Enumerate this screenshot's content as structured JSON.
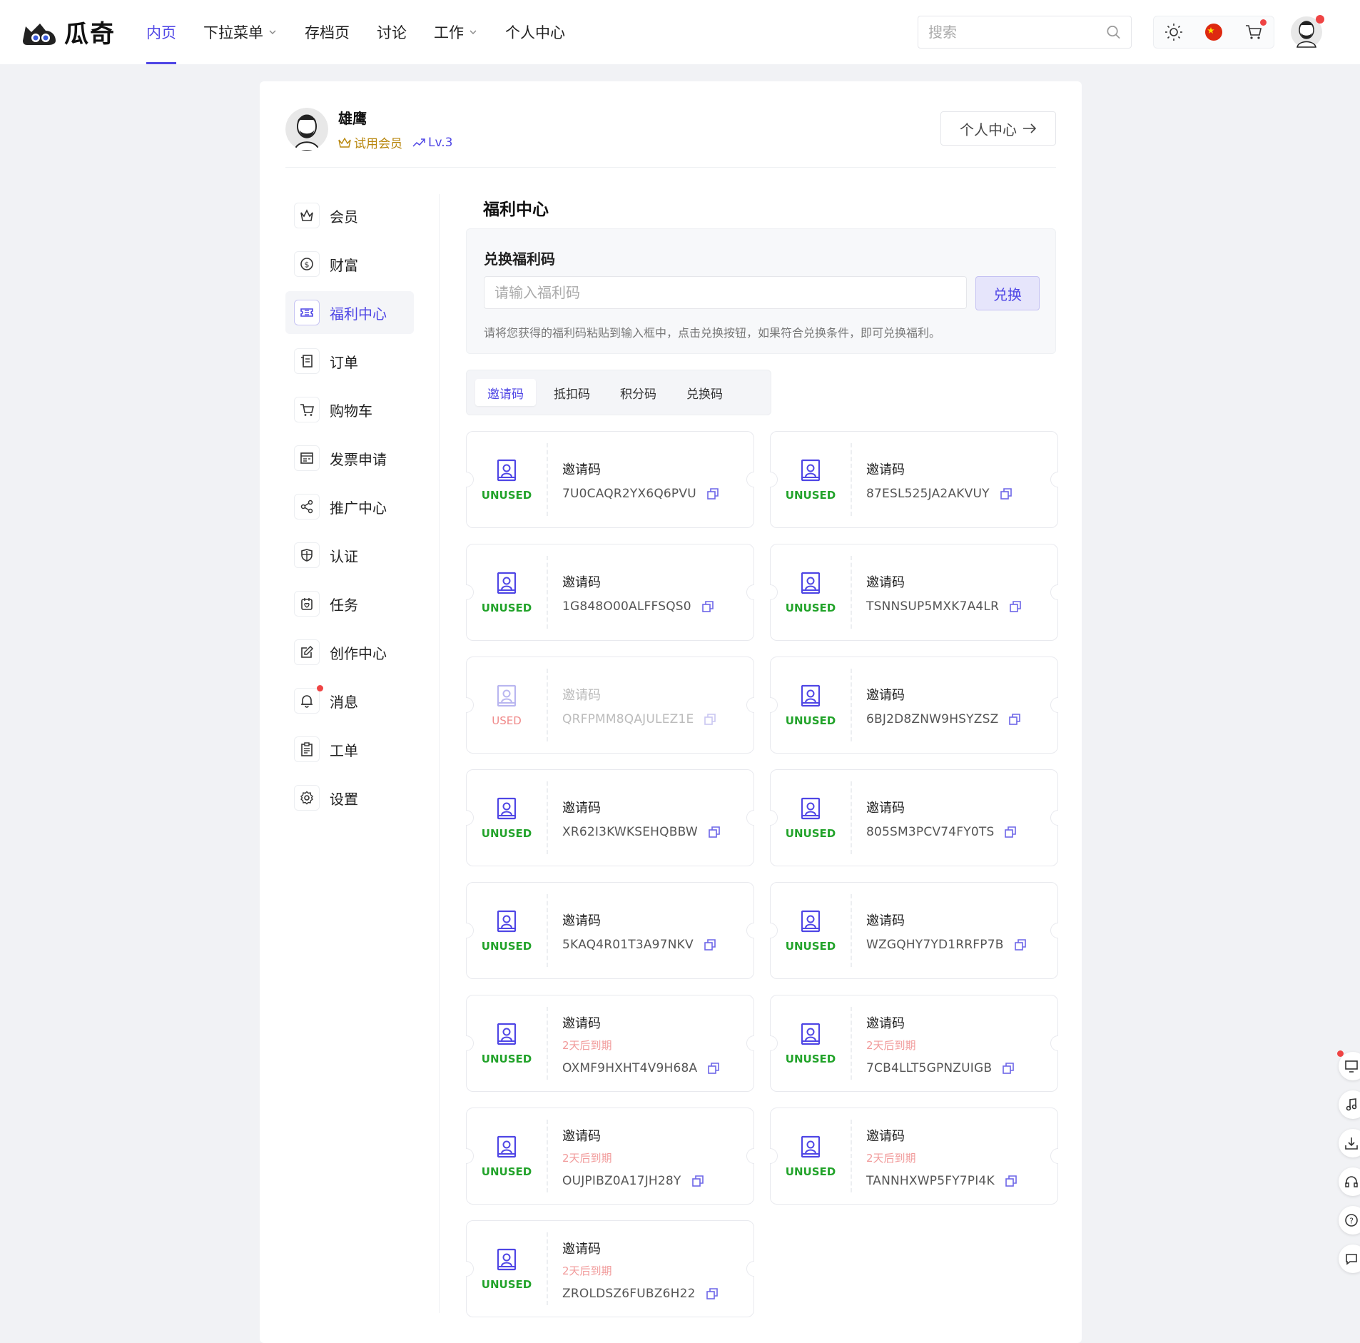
{
  "header": {
    "logo_text": "瓜奇",
    "nav": [
      {
        "label": "内页",
        "active": true,
        "dropdown": false
      },
      {
        "label": "下拉菜单",
        "active": false,
        "dropdown": true
      },
      {
        "label": "存档页",
        "active": false,
        "dropdown": false
      },
      {
        "label": "讨论",
        "active": false,
        "dropdown": false
      },
      {
        "label": "工作",
        "active": false,
        "dropdown": true
      },
      {
        "label": "个人中心",
        "active": false,
        "dropdown": false
      }
    ],
    "search_placeholder": "搜索",
    "tools": [
      "sun-icon",
      "flag-cn-icon",
      "cart-icon"
    ]
  },
  "profile": {
    "name": "雄鹰",
    "member": "试用会员",
    "level": "Lv.3",
    "center_button": "个人中心"
  },
  "sidebar": [
    {
      "label": "会员",
      "icon": "crown-icon",
      "active": false
    },
    {
      "label": "财富",
      "icon": "coin-icon",
      "active": false
    },
    {
      "label": "福利中心",
      "icon": "ticket-icon",
      "active": true
    },
    {
      "label": "订单",
      "icon": "receipt-icon",
      "active": false
    },
    {
      "label": "购物车",
      "icon": "cart-icon",
      "active": false
    },
    {
      "label": "发票申请",
      "icon": "invoice-icon",
      "active": false
    },
    {
      "label": "推广中心",
      "icon": "share-icon",
      "active": false
    },
    {
      "label": "认证",
      "icon": "shield-icon",
      "active": false
    },
    {
      "label": "任务",
      "icon": "task-icon",
      "active": false
    },
    {
      "label": "创作中心",
      "icon": "edit-icon",
      "active": false
    },
    {
      "label": "消息",
      "icon": "bell-icon",
      "active": false,
      "badge": true
    },
    {
      "label": "工单",
      "icon": "clipboard-icon",
      "active": false
    },
    {
      "label": "设置",
      "icon": "gear-icon",
      "active": false
    }
  ],
  "main": {
    "title": "福利中心",
    "redeem": {
      "title": "兑换福利码",
      "placeholder": "请输入福利码",
      "button": "兑换",
      "hint": "请将您获得的福利码粘贴到输入框中，点击兑换按钮，如果符合兑换条件，即可兑换福利。"
    },
    "tabs": [
      {
        "label": "邀请码",
        "active": true
      },
      {
        "label": "抵扣码",
        "active": false
      },
      {
        "label": "积分码",
        "active": false
      },
      {
        "label": "兑换码",
        "active": false
      }
    ],
    "coupons": [
      {
        "label": "邀请码",
        "code": "7U0CAQR2YX6Q6PVU",
        "status": "UNUSED",
        "expire": ""
      },
      {
        "label": "邀请码",
        "code": "87ESL525JA2AKVUY",
        "status": "UNUSED",
        "expire": ""
      },
      {
        "label": "邀请码",
        "code": "1G848O00ALFFSQS0",
        "status": "UNUSED",
        "expire": ""
      },
      {
        "label": "邀请码",
        "code": "TSNNSUP5MXK7A4LR",
        "status": "UNUSED",
        "expire": ""
      },
      {
        "label": "邀请码",
        "code": "QRFPMM8QAJULEZ1E",
        "status": "USED",
        "expire": ""
      },
      {
        "label": "邀请码",
        "code": "6BJ2D8ZNW9HSYZSZ",
        "status": "UNUSED",
        "expire": ""
      },
      {
        "label": "邀请码",
        "code": "XR62I3KWKSEHQBBW",
        "status": "UNUSED",
        "expire": ""
      },
      {
        "label": "邀请码",
        "code": "805SM3PCV74FY0TS",
        "status": "UNUSED",
        "expire": ""
      },
      {
        "label": "邀请码",
        "code": "5KAQ4R01T3A97NKV",
        "status": "UNUSED",
        "expire": ""
      },
      {
        "label": "邀请码",
        "code": "WZGQHY7YD1RRFP7B",
        "status": "UNUSED",
        "expire": ""
      },
      {
        "label": "邀请码",
        "code": "OXMF9HXHT4V9H68A",
        "status": "UNUSED",
        "expire": "2天后到期"
      },
      {
        "label": "邀请码",
        "code": "7CB4LLT5GPNZUIGB",
        "status": "UNUSED",
        "expire": "2天后到期"
      },
      {
        "label": "邀请码",
        "code": "OUJPIBZ0A17JH28Y",
        "status": "UNUSED",
        "expire": "2天后到期"
      },
      {
        "label": "邀请码",
        "code": "TANNHXWP5FY7PI4K",
        "status": "UNUSED",
        "expire": "2天后到期"
      },
      {
        "label": "邀请码",
        "code": "ZROLDSZ6FUBZ6H22",
        "status": "UNUSED",
        "expire": "2天后到期"
      }
    ]
  },
  "float_tools": [
    "monitor-icon",
    "music-icon",
    "download-icon",
    "headset-icon",
    "help-icon",
    "chat-icon"
  ],
  "colors": {
    "accent": "#4f46e5",
    "unused": "#22a32a",
    "used": "#f08a8a",
    "expire": "#f19a9a",
    "member": "#b8860b"
  }
}
